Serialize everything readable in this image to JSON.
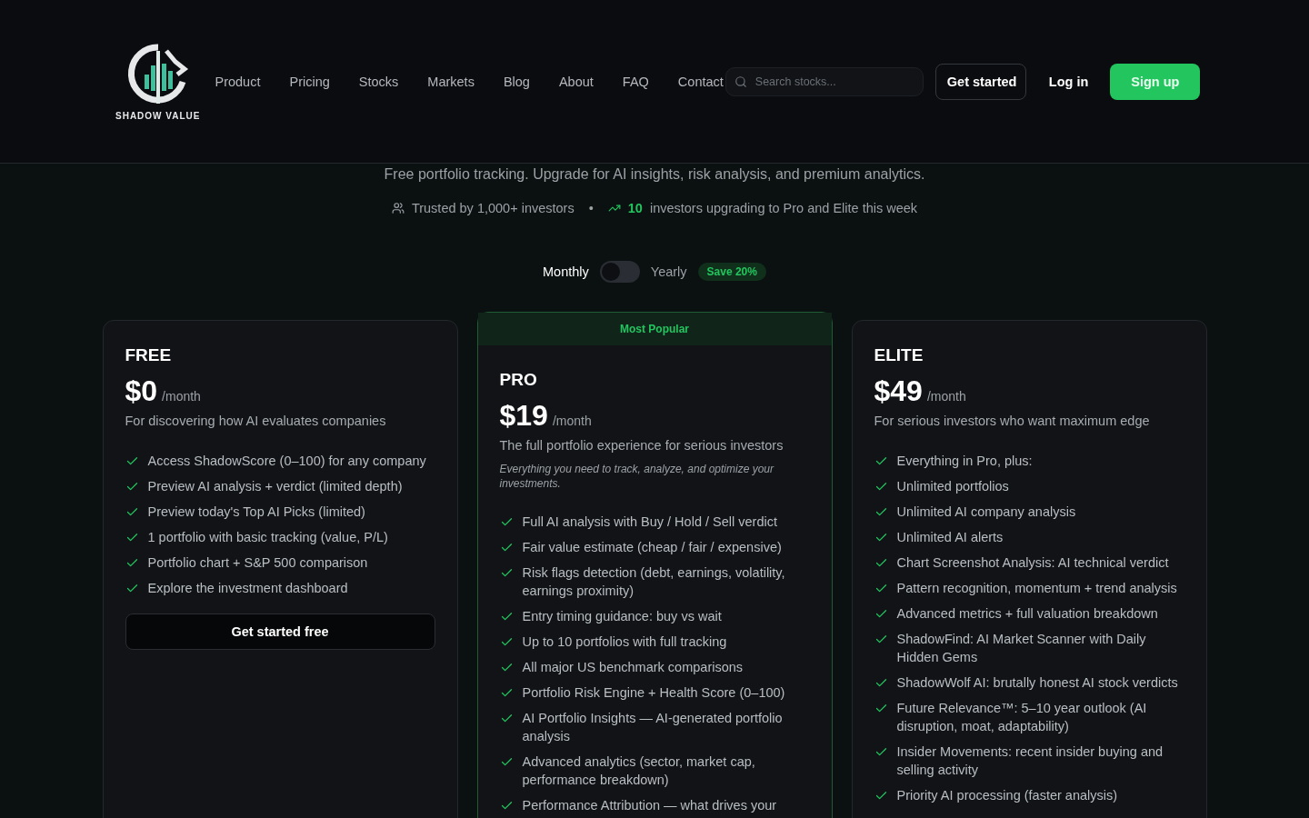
{
  "header": {
    "brand": "SHADOW VALUE",
    "nav": [
      "Product",
      "Pricing",
      "Stocks",
      "Markets",
      "Blog",
      "About",
      "FAQ",
      "Contact"
    ],
    "search": {
      "placeholder": "Search stocks..."
    },
    "buttons": [
      {
        "label": "Get started",
        "kind": "outline"
      },
      {
        "label": "Log in",
        "kind": "ghost"
      },
      {
        "label": "Sign up",
        "kind": "primary"
      }
    ]
  },
  "subtitle": "Free portfolio tracking. Upgrade for AI insights, risk analysis, and premium analytics.",
  "trust": {
    "investors": "Trusted by 1,000+ investors",
    "separator": "•",
    "count": "10",
    "upgrading": "investors upgrading to Pro and Elite this week"
  },
  "billing": {
    "monthly": "Monthly",
    "yearly_label": "Yearly",
    "yearly": false,
    "save": "Save 20%"
  },
  "plans": [
    {
      "name": "FREE",
      "price": "$0",
      "period": "/month",
      "tagline": "For discovering how AI evaluates companies",
      "popular": false,
      "features": [
        "Access ShadowScore (0–100) for any company",
        "Preview AI analysis + verdict (limited depth)",
        "Preview today's Top AI Picks (limited)",
        "1 portfolio with basic tracking (value, P/L)",
        "Portfolio chart + S&P 500 comparison",
        "Explore the investment dashboard"
      ],
      "cta": "Get started free"
    },
    {
      "name": "PRO",
      "price": "$19",
      "period": "/month",
      "tagline": "The full portfolio experience for serious investors",
      "note": "Everything you need to track, analyze, and optimize your investments.",
      "popular": true,
      "badge": "Most Popular",
      "features": [
        "Full AI analysis with Buy / Hold / Sell verdict",
        "Fair value estimate (cheap / fair / expensive)",
        "Risk flags detection (debt, earnings, volatility, earnings proximity)",
        "Entry timing guidance: buy vs wait",
        "Up to 10 portfolios with full tracking",
        "All major US benchmark comparisons",
        "Portfolio Risk Engine + Health Score (0–100)",
        "AI Portfolio Insights — AI-generated portfolio analysis",
        "Advanced analytics (sector, market cap, performance breakdown)",
        "Performance Attribution — what drives your"
      ]
    },
    {
      "name": "ELITE",
      "price": "$49",
      "period": "/month",
      "tagline": "For serious investors who want maximum edge",
      "popular": false,
      "features": [
        "Everything in Pro, plus:",
        "Unlimited portfolios",
        "Unlimited AI company analysis",
        "Unlimited AI alerts",
        "Chart Screenshot Analysis: AI technical verdict",
        "Pattern recognition, momentum + trend analysis",
        "Advanced metrics + full valuation breakdown",
        "ShadowFind: AI Market Scanner with Daily Hidden Gems",
        "ShadowWolf AI: brutally honest AI stock verdicts",
        "Future Relevance™: 5–10 year outlook (AI disruption, moat, adaptability)",
        "Insider Movements: recent insider buying and selling activity",
        "Priority AI processing (faster analysis)"
      ]
    }
  ]
}
